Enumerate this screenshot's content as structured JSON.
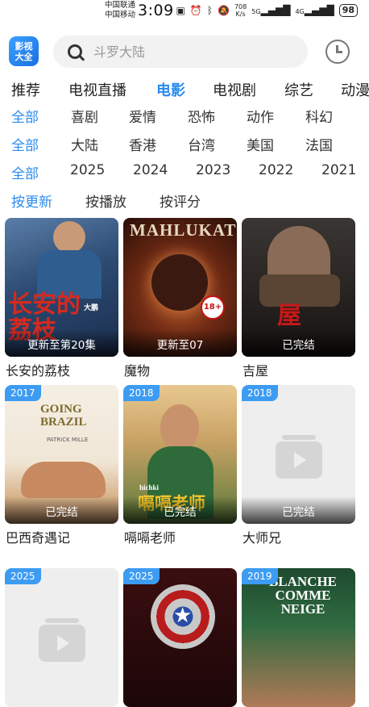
{
  "status_bar": {
    "carrier1": "中国联通",
    "carrier2": "中国移动",
    "time": "3:09",
    "speed_value": "708",
    "speed_unit": "K/s",
    "net1": "5G",
    "net2": "4G",
    "battery": "98"
  },
  "header": {
    "logo_line1": "影视",
    "logo_line2": "大全",
    "search_placeholder": "斗罗大陆"
  },
  "tabs": [
    "推荐",
    "电视直播",
    "电影",
    "电视剧",
    "综艺",
    "动漫"
  ],
  "active_tab": "电影",
  "filters": {
    "genre": [
      "全部",
      "喜剧",
      "爱情",
      "恐怖",
      "动作",
      "科幻"
    ],
    "region": [
      "全部",
      "大陆",
      "香港",
      "台湾",
      "美国",
      "法国"
    ],
    "year": [
      "全部",
      "2025",
      "2024",
      "2023",
      "2022",
      "2021"
    ],
    "sort": [
      "按更新",
      "按播放",
      "按评分"
    ]
  },
  "movies": [
    {
      "title": "长安的荔枝",
      "year": "",
      "status": "更新至第20集",
      "poster_text": "长安的荔枝",
      "poster_small": "大鹏"
    },
    {
      "title": "魔物",
      "year": "",
      "status": "更新至07",
      "poster_text": "MAHLUKAT",
      "poster_small": "18+"
    },
    {
      "title": "吉屋",
      "year": "",
      "status": "已完结",
      "poster_text": "屋",
      "poster_small": ""
    },
    {
      "title": "巴西奇遇记",
      "year": "2017",
      "status": "已完结",
      "poster_text": "GOING BRAZIL",
      "poster_small": "PATRICK MILLE"
    },
    {
      "title": "嗝嗝老师",
      "year": "2018",
      "status": "已完结",
      "poster_text": "嗝嗝老师",
      "poster_small": "hichki"
    },
    {
      "title": "大师兄",
      "year": "2018",
      "status": "已完结",
      "poster_text": "",
      "poster_small": ""
    },
    {
      "title": "",
      "year": "2025",
      "status": "",
      "poster_text": "",
      "poster_small": ""
    },
    {
      "title": "",
      "year": "2025",
      "status": "",
      "poster_text": "",
      "poster_small": ""
    },
    {
      "title": "",
      "year": "2019",
      "status": "",
      "poster_text": "BLANCHE COMME NEIGE",
      "poster_small": ""
    }
  ],
  "colors": {
    "accent": "#2a8cf0",
    "badge": "#3d9cf2",
    "placeholder": "#eeeeee"
  }
}
